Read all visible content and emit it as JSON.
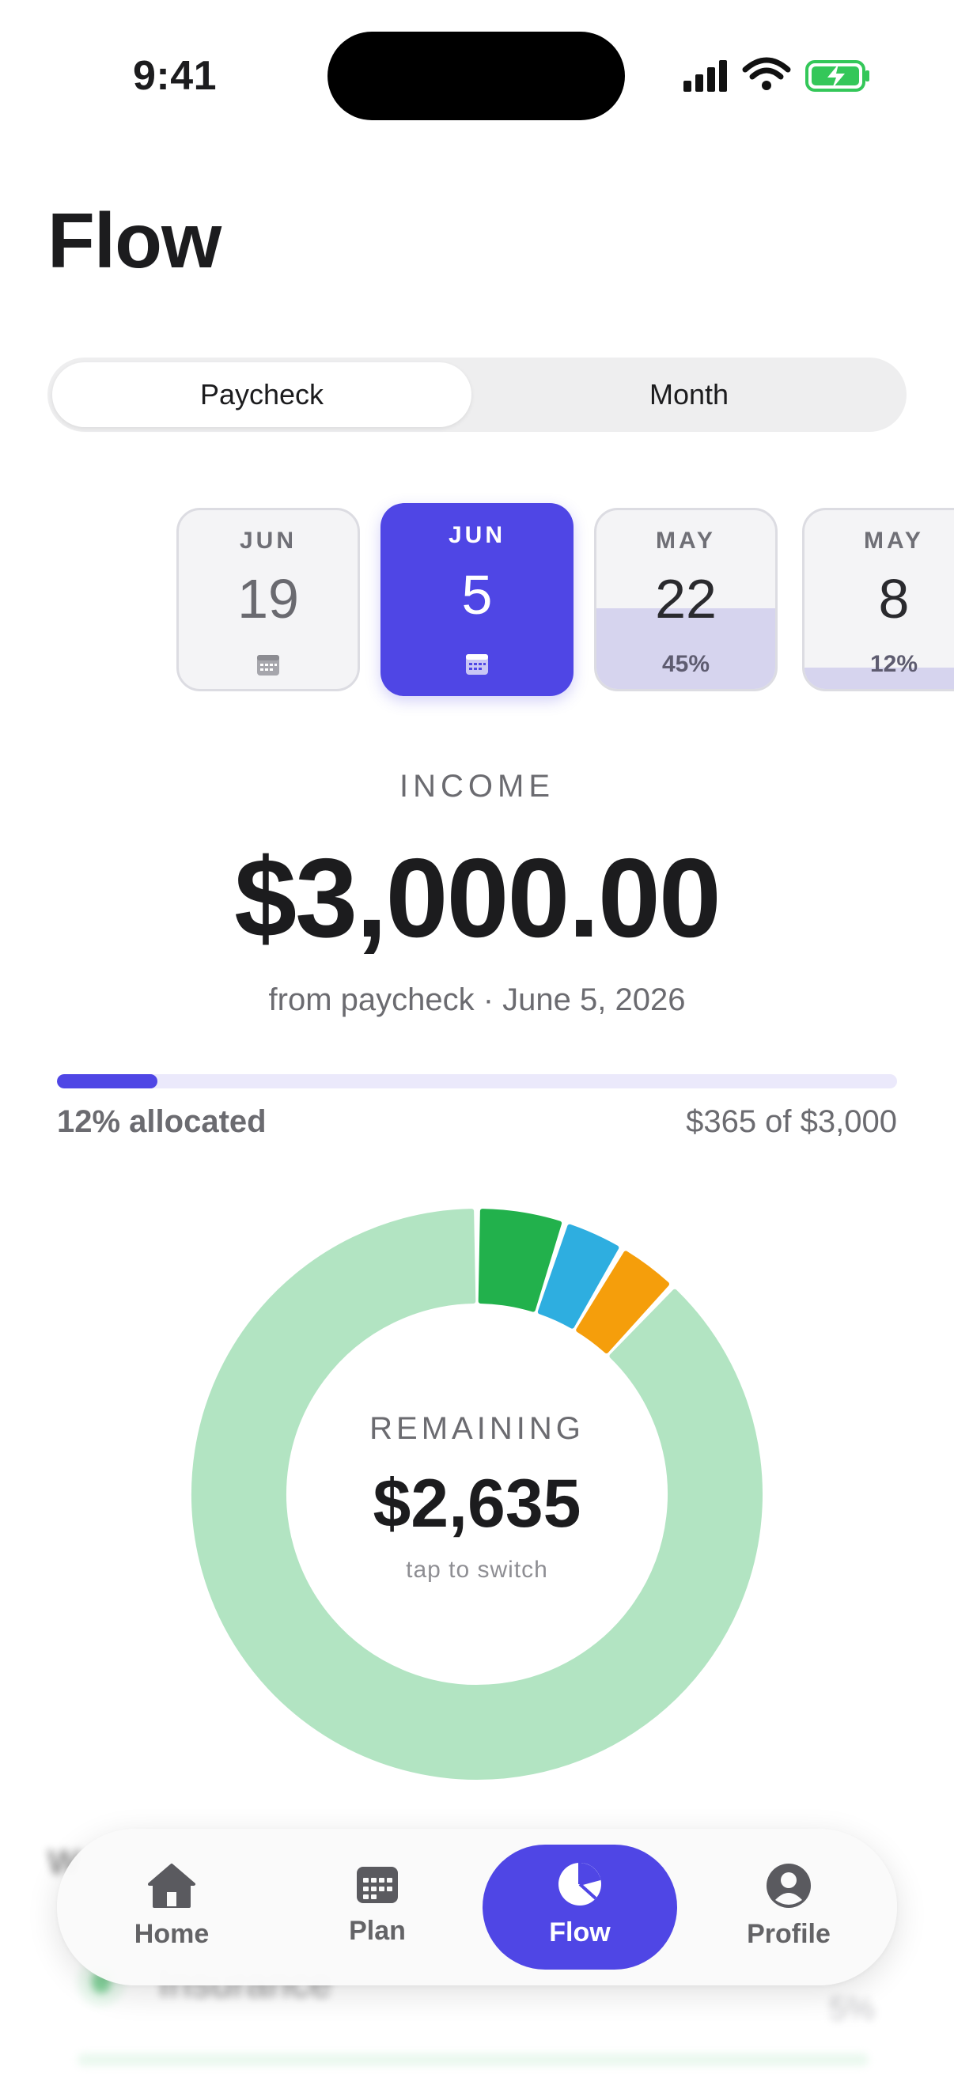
{
  "status": {
    "time": "9:41"
  },
  "page": {
    "title": "Flow"
  },
  "segment": {
    "options": [
      "Paycheck",
      "Month"
    ],
    "selected": "Paycheck"
  },
  "paychecks": [
    {
      "month": "JUN",
      "day": "19",
      "state": "upcoming",
      "icon": "calendar-icon"
    },
    {
      "month": "JUN",
      "day": "5",
      "state": "selected",
      "icon": "calendar-icon"
    },
    {
      "month": "MAY",
      "day": "22",
      "state": "past",
      "allocated_pct": 45,
      "pct_label": "45%"
    },
    {
      "month": "MAY",
      "day": "8",
      "state": "past",
      "allocated_pct": 12,
      "pct_label": "12%"
    }
  ],
  "income": {
    "label": "INCOME",
    "amount": "$3,000.00",
    "source": "from paycheck · June 5, 2026",
    "allocated_fraction": 0.12,
    "allocated_label": "12% allocated",
    "allocated_summary": "$365 of $3,000"
  },
  "chart_data": {
    "type": "pie",
    "variant": "donut",
    "segments": [
      {
        "color": "#22b14c",
        "value": 5
      },
      {
        "color": "#2eaee0",
        "value": 3.5
      },
      {
        "color": "#f59e0b",
        "value": 3.5
      },
      {
        "color": "#b2e4c2",
        "value": 88
      }
    ],
    "center_label": "REMAINING",
    "center_value": "$2,635",
    "center_hint": "tap to switch"
  },
  "list_preview": {
    "heading": "W",
    "item_name": "Insurance",
    "item_pct": "5%"
  },
  "tabbar": {
    "items": [
      {
        "label": "Home",
        "icon": "house-icon"
      },
      {
        "label": "Plan",
        "icon": "calendar-grid-icon"
      },
      {
        "label": "Flow",
        "icon": "pie-chart-icon",
        "active": true
      },
      {
        "label": "Profile",
        "icon": "person-circle-icon"
      }
    ]
  },
  "colors": {
    "accent": "#4f46e5",
    "remaining": "#b2e4c2",
    "text": "#1c1c1e",
    "secondary": "#6b6b70"
  }
}
